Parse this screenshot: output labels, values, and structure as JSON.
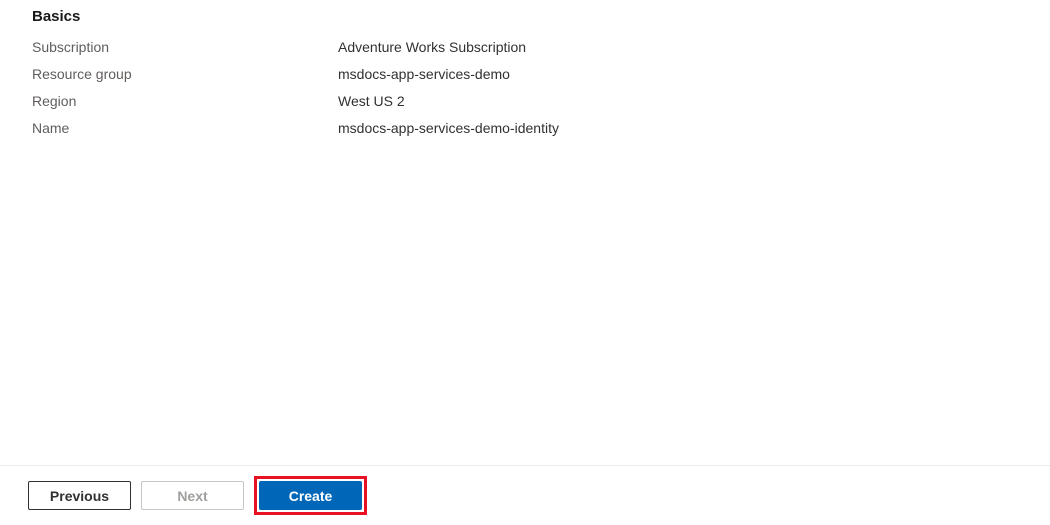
{
  "section": {
    "heading": "Basics",
    "rows": [
      {
        "label": "Subscription",
        "value": "Adventure Works Subscription"
      },
      {
        "label": "Resource group",
        "value": "msdocs-app-services-demo"
      },
      {
        "label": "Region",
        "value": "West US 2"
      },
      {
        "label": "Name",
        "value": "msdocs-app-services-demo-identity"
      }
    ]
  },
  "footer": {
    "previous": "Previous",
    "next": "Next",
    "create": "Create"
  }
}
